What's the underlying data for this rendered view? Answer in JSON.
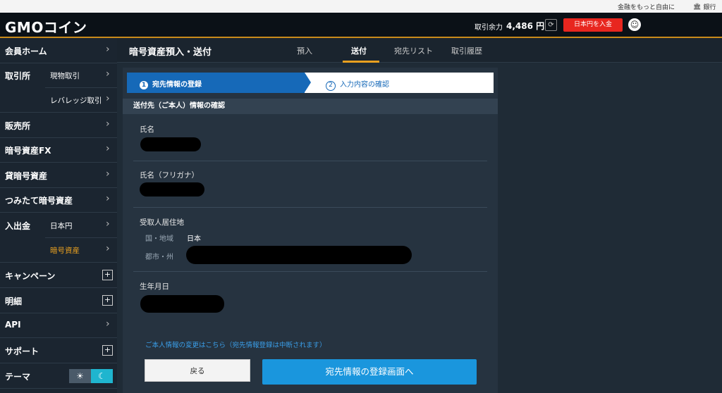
{
  "topbar": {
    "tagline": "金融をもっと自由に",
    "bank_label": "銀行"
  },
  "header": {
    "logo_text": "GMOコイン",
    "balance_label": "取引余力",
    "balance_value": "4,486 円",
    "deposit_button": "日本円を入金"
  },
  "sidebar": {
    "member_home": "会員ホーム",
    "exchange": "取引所",
    "spot": "現物取引",
    "leverage": "レバレッジ取引",
    "sales": "販売所",
    "crypto_fx": "暗号資産FX",
    "lending": "貸暗号資産",
    "tsumitate": "つみたて暗号資産",
    "deposit_withdraw": "入出金",
    "jpy": "日本円",
    "crypto": "暗号資産",
    "campaign": "キャンペーン",
    "details": "明細",
    "api": "API",
    "support": "サポート",
    "theme": "テーマ"
  },
  "main": {
    "title": "暗号資産預入・送付",
    "tabs": [
      "預入",
      "送付",
      "宛先リスト",
      "取引履歴"
    ],
    "active_tab": "送付"
  },
  "steps": {
    "step1_num": "1",
    "step1": "宛先情報の登録",
    "step2_num": "2",
    "step2": "入力内容の確認"
  },
  "form": {
    "section_title": "送付先（ご本人）情報の確認",
    "name_label": "氏名",
    "furigana_label": "氏名（フリガナ）",
    "address_label": "受取人居住地",
    "country_label": "国・地域",
    "country_value": "日本",
    "city_label": "都市・州",
    "dob_label": "生年月日",
    "change_link": "ご本人情報の変更はこちら（宛先情報登録は中断されます）",
    "back_button": "戻る",
    "next_button": "宛先情報の登録画面へ"
  },
  "colors": {
    "accent_orange": "#e8a020",
    "deposit_red": "#e8261f",
    "step_blue": "#1669b8",
    "cta_blue": "#1a96dd"
  }
}
